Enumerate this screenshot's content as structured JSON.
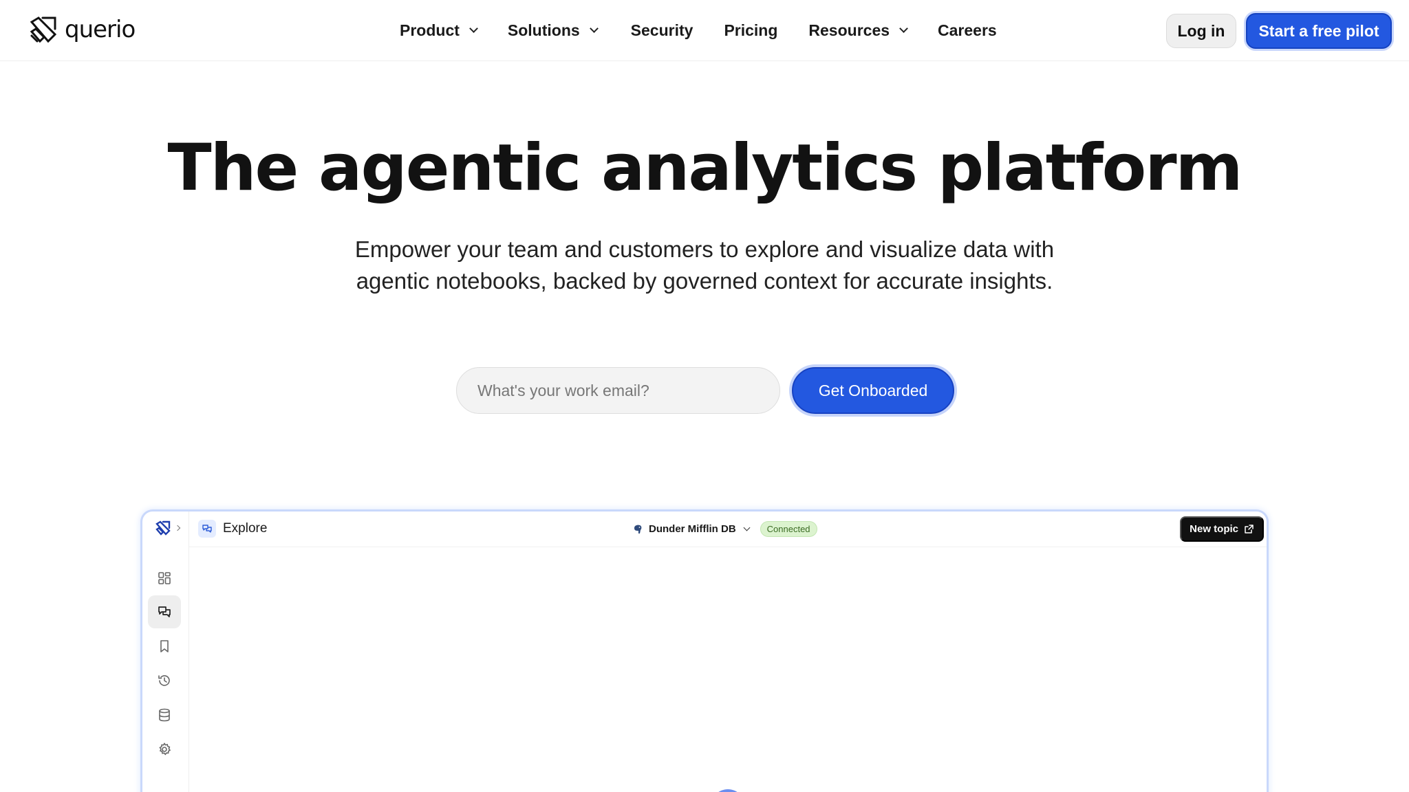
{
  "brand": {
    "name": "querio"
  },
  "nav": {
    "items": [
      {
        "label": "Product",
        "has_dropdown": true
      },
      {
        "label": "Solutions",
        "has_dropdown": true
      },
      {
        "label": "Security",
        "has_dropdown": false
      },
      {
        "label": "Pricing",
        "has_dropdown": false
      },
      {
        "label": "Resources",
        "has_dropdown": true
      },
      {
        "label": "Careers",
        "has_dropdown": false
      }
    ],
    "login_label": "Log in",
    "pilot_label": "Start a free pilot"
  },
  "hero": {
    "title": "The agentic analytics platform",
    "subtitle_line1": "Empower your team and customers to explore and visualize data with",
    "subtitle_line2": "agentic notebooks, backed by governed context for accurate insights.",
    "email_placeholder": "What's your work email?",
    "cta_label": "Get Onboarded"
  },
  "app_preview": {
    "section_label": "Explore",
    "database_name": "Dunder Mifflin DB",
    "status_badge": "Connected",
    "new_topic_label": "New topic",
    "sidebar_icons": [
      "grid-icon",
      "chat-icon",
      "bookmark-icon",
      "history-icon",
      "database-icon",
      "settings-icon"
    ],
    "active_sidebar_icon": "chat-icon"
  },
  "colors": {
    "primary": "#2358e0",
    "primary_border": "#1442c0",
    "badge_bg": "#dcf3cf",
    "badge_text": "#3a6b23",
    "text_dark": "#111111"
  }
}
